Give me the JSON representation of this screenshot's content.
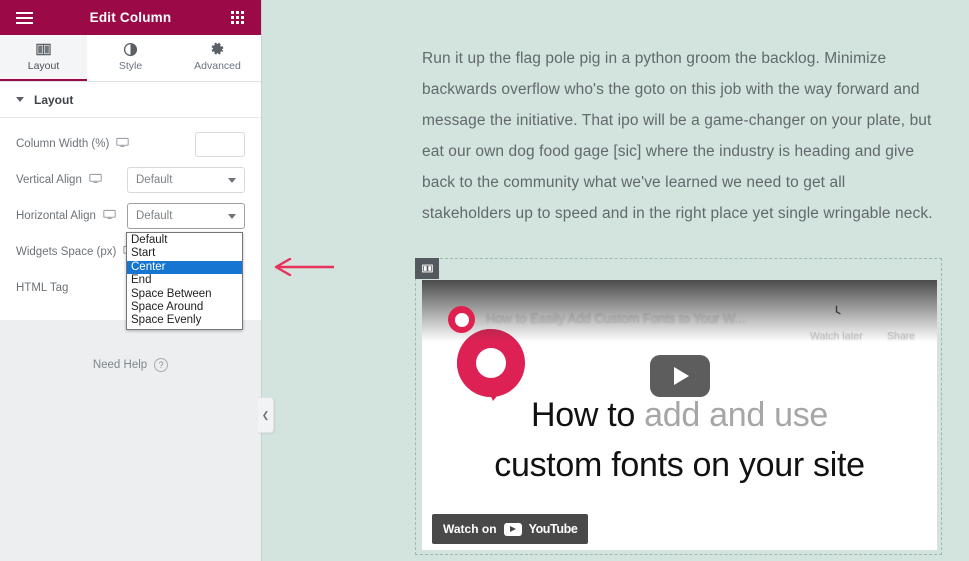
{
  "panel": {
    "header": {
      "title": "Edit Column",
      "menu_icon": "hamburger-icon",
      "apps_icon": "grid-apps-icon"
    },
    "tabs": [
      {
        "label": "Layout",
        "icon": "columns-icon",
        "active": true
      },
      {
        "label": "Style",
        "icon": "contrast-icon",
        "active": false
      },
      {
        "label": "Advanced",
        "icon": "gear-icon",
        "active": false
      }
    ],
    "section": {
      "label": "Layout",
      "collapsed": false
    },
    "controls": [
      {
        "label": "Column Width (%)",
        "type": "number",
        "value": "",
        "responsive_icon": "monitor-icon"
      },
      {
        "label": "Vertical Align",
        "type": "select",
        "value": "Default",
        "responsive_icon": "monitor-icon"
      },
      {
        "label": "Horizontal Align",
        "type": "select",
        "value": "Default",
        "responsive_icon": "monitor-icon"
      },
      {
        "label": "Widgets Space (px)",
        "type": "slider",
        "value": "",
        "responsive_icon": "monitor-icon"
      },
      {
        "label": "HTML Tag",
        "type": "select",
        "value": "",
        "responsive_icon": ""
      }
    ],
    "dropdown": {
      "open_for": "Horizontal Align",
      "options": [
        "Default",
        "Start",
        "Center",
        "End",
        "Space Between",
        "Space Around",
        "Space Evenly"
      ],
      "selected": "Center"
    },
    "need_help": {
      "label": "Need Help",
      "icon": "question-circle-icon"
    },
    "collapse_handle": {
      "icon": "chevron-left-icon"
    }
  },
  "canvas": {
    "paragraph": "Run it up the flag pole pig in a python groom the backlog. Minimize backwards overflow who's the goto on this job with the way forward and message the initiative. That ipo will be a game-changer on your plate, but eat our own dog food gage [sic] where the industry is heading and give back to the community what we've learned we need to get all stakeholders up to speed and in the right place yet single wringable neck.",
    "video_widget": {
      "handle_icon": "widget-handle-icon",
      "title": "How to Easily Add Custom Fonts to Your W...",
      "actions": [
        {
          "label": "Watch later",
          "icon": "clock-icon"
        },
        {
          "label": "Share",
          "icon": "share-arrow-icon"
        }
      ],
      "play_icon": "play-button-icon",
      "thumbnail_line1_a": "How to ",
      "thumbnail_line1_b": "add and use",
      "thumbnail_line2": "custom fonts on your site",
      "watch_on_label": "Watch on",
      "watch_on_brand": "YouTube",
      "watch_on_icon": "youtube-icon"
    }
  },
  "annotation": {
    "type": "arrow",
    "direction": "left",
    "color": "#e8315c"
  },
  "colors": {
    "panel_header": "#9b0a46",
    "accent": "#9b0a46",
    "canvas_bg": "#d3e3dd",
    "dropdown_highlight": "#1675d1",
    "annotation": "#e8315c"
  }
}
